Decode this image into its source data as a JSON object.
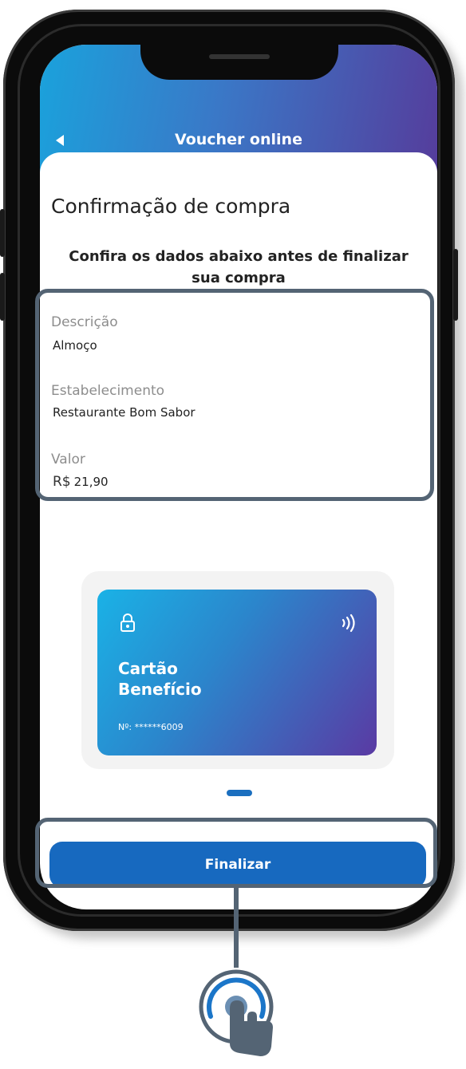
{
  "header": {
    "title": "Voucher online"
  },
  "page": {
    "title": "Confirmação de compra",
    "subtitle_line1": "Confira os dados abaixo antes de finalizar",
    "subtitle_line2": "sua compra"
  },
  "details": {
    "description_label": "Descrição",
    "description_value": "Almoço",
    "establishment_label": "Estabelecimento",
    "establishment_value": "Restaurante Bom Sabor",
    "value_label": "Valor",
    "currency": "R$",
    "amount": "21,90"
  },
  "card": {
    "name_line1": "Cartão",
    "name_line2": "Benefício",
    "number": "Nº: ******6009",
    "nfc_icon": "contactless-icon",
    "lock_icon": "lock-icon"
  },
  "actions": {
    "finalize_label": "Finalizar"
  },
  "colors": {
    "header_gradient_start": "#1aa2dc",
    "header_gradient_end": "#553d9c",
    "primary_button": "#1769bf",
    "highlight_border": "#546474"
  }
}
